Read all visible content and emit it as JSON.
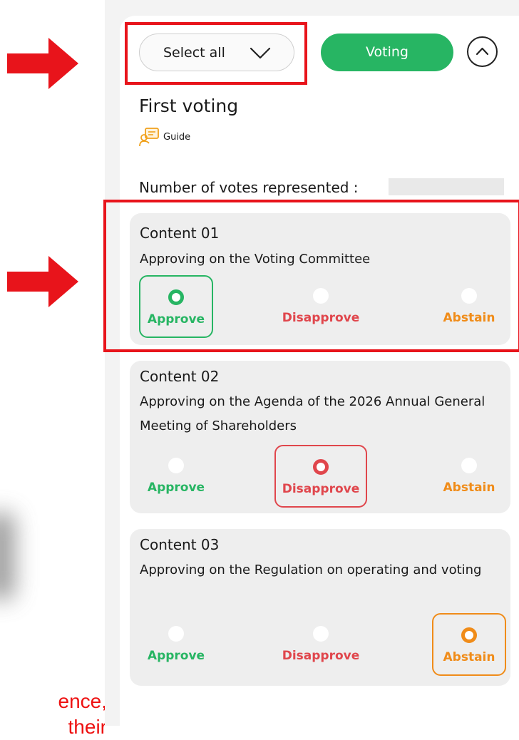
{
  "header": {
    "select_all_label": "Select all",
    "voting_button_label": "Voting"
  },
  "section": {
    "title": "First voting",
    "guide_label": "Guide",
    "votes_represented_label": "Number of votes represented :"
  },
  "contents": [
    {
      "heading": "Content 01",
      "description": "Approving on the Voting Committee",
      "selected": "Approve"
    },
    {
      "heading": "Content 02",
      "description": "Approving on the Agenda of the 2026 Annual General Meeting of Shareholders",
      "selected": "Disapprove"
    },
    {
      "heading": "Content 03",
      "description": "Approving on the Regulation on operating and voting",
      "selected": "Abstain"
    }
  ],
  "options": {
    "approve": "Approve",
    "disapprove": "Disapprove",
    "abstain": "Abstain"
  },
  "side_note": {
    "line1": "ence,",
    "line2": "their"
  },
  "colors": {
    "approve": "#27b563",
    "disapprove": "#e0464c",
    "abstain": "#f08c19",
    "callout": "#e8141b",
    "voting_button": "#27b563"
  },
  "icons": [
    "arrow-right-icon",
    "chevron-down-icon",
    "chevron-up-icon",
    "guide-icon"
  ]
}
